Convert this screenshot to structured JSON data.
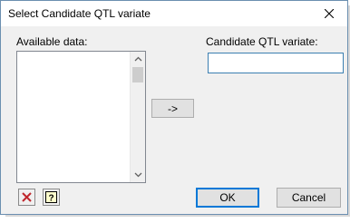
{
  "window": {
    "title": "Select Candidate QTL variate"
  },
  "available": {
    "label": "Available data:"
  },
  "candidate": {
    "label": "Candidate QTL variate:",
    "value": ""
  },
  "buttons": {
    "move": "->",
    "ok": "OK",
    "cancel": "Cancel"
  },
  "icons": {
    "close": "close-icon",
    "clear": "clear-x-icon",
    "help": "help-icon",
    "scroll_up": "chevron-up-icon",
    "scroll_down": "chevron-down-icon"
  },
  "colors": {
    "clear_icon": "#c0272d",
    "default_button_border": "#0078d7"
  }
}
